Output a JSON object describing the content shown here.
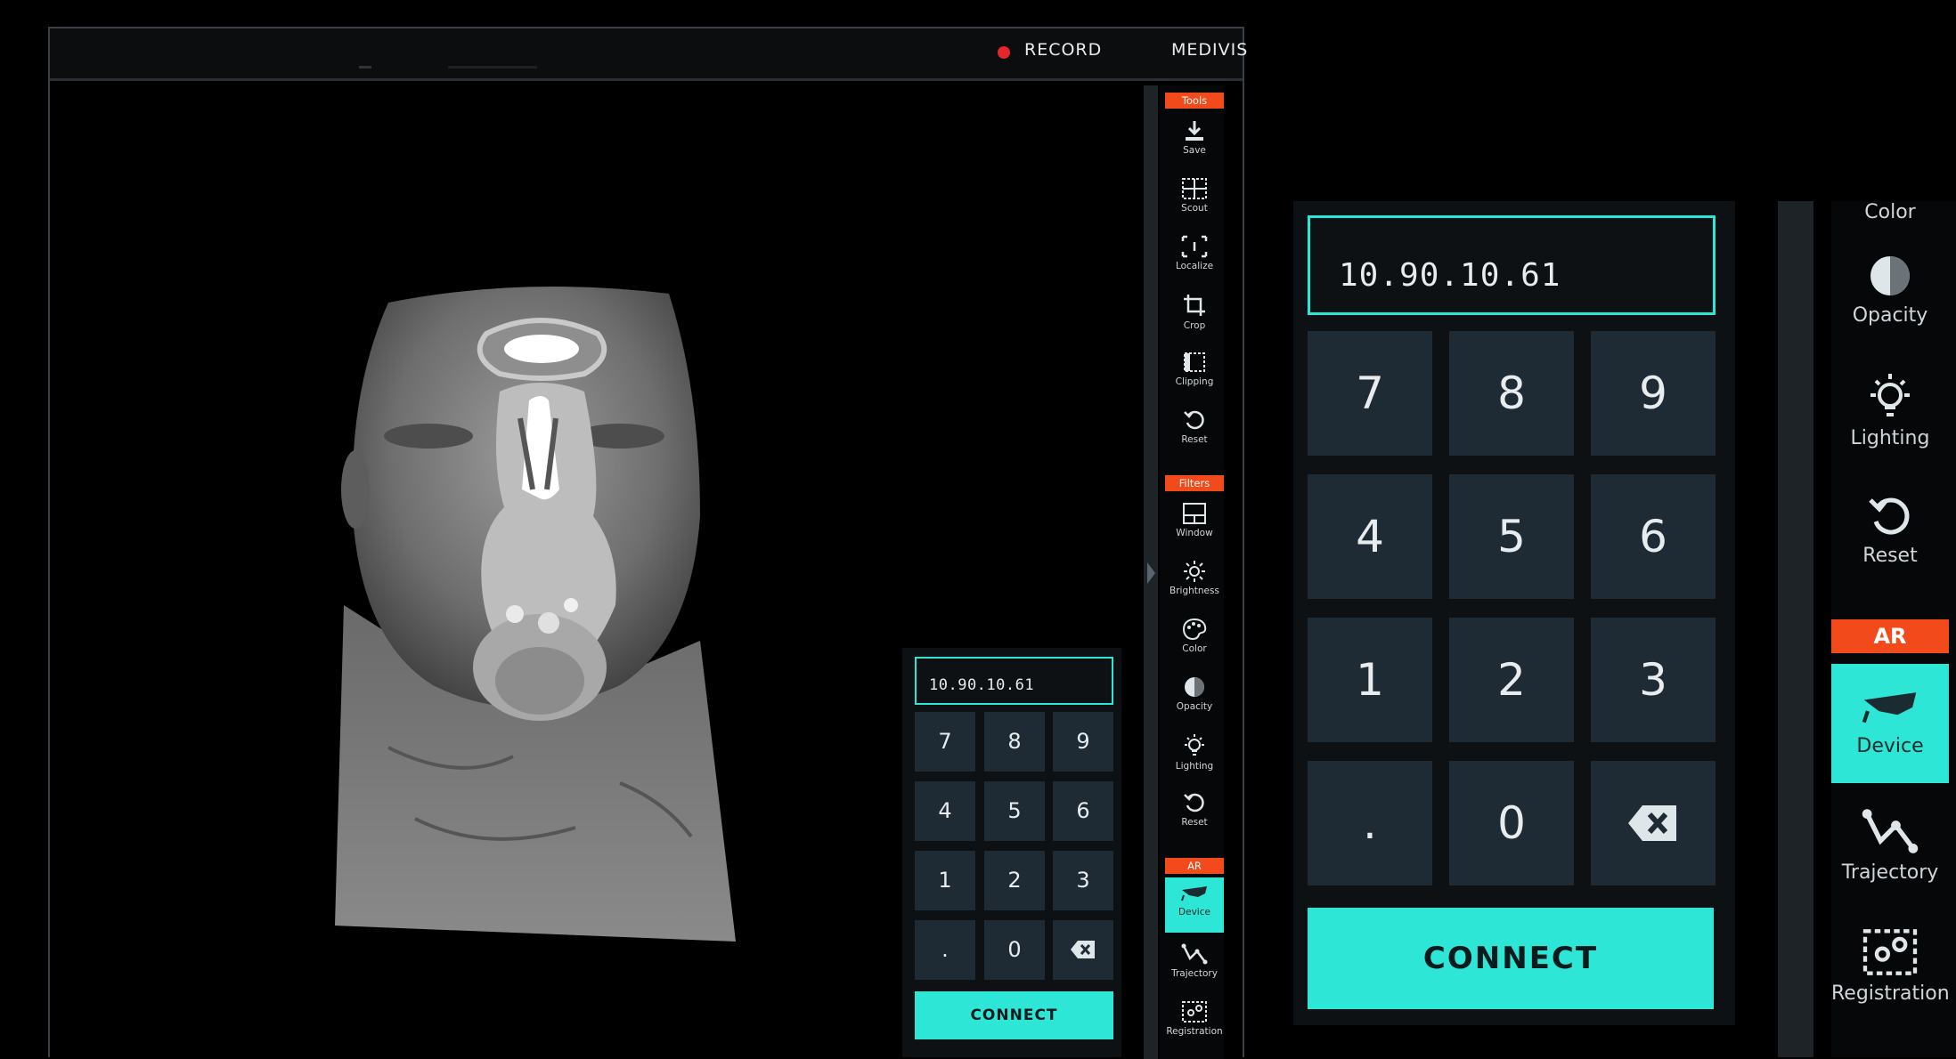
{
  "window": {
    "record_label": "RECORD",
    "brand": "MEDIVIS"
  },
  "toolbar": {
    "sections": [
      {
        "label": "Tools",
        "items": [
          "Save",
          "Scout",
          "Localize",
          "Crop",
          "Clipping",
          "Reset"
        ]
      },
      {
        "label": "Filters",
        "items": [
          "Window",
          "Brightness",
          "Color",
          "Opacity",
          "Lighting",
          "Reset"
        ]
      },
      {
        "label": "AR",
        "items": [
          "Device",
          "Trajectory",
          "Registration"
        ]
      }
    ],
    "active_item": "Device"
  },
  "keypad": {
    "ip_value": "10.90.10.61",
    "keys": [
      "7",
      "8",
      "9",
      "4",
      "5",
      "6",
      "1",
      "2",
      "3",
      ".",
      "0"
    ],
    "backspace_icon": "backspace-icon",
    "connect_label": "CONNECT"
  },
  "zoom_toolbar": {
    "items_top": [
      "Color",
      "Opacity",
      "Lighting",
      "Reset"
    ],
    "section": "AR",
    "items_ar": [
      "Device",
      "Trajectory",
      "Registration"
    ]
  },
  "colors": {
    "accent": "#2ee6d6",
    "section_header": "#f24a1a",
    "record_dot": "#e6262a",
    "key_bg": "#1e2b35"
  }
}
